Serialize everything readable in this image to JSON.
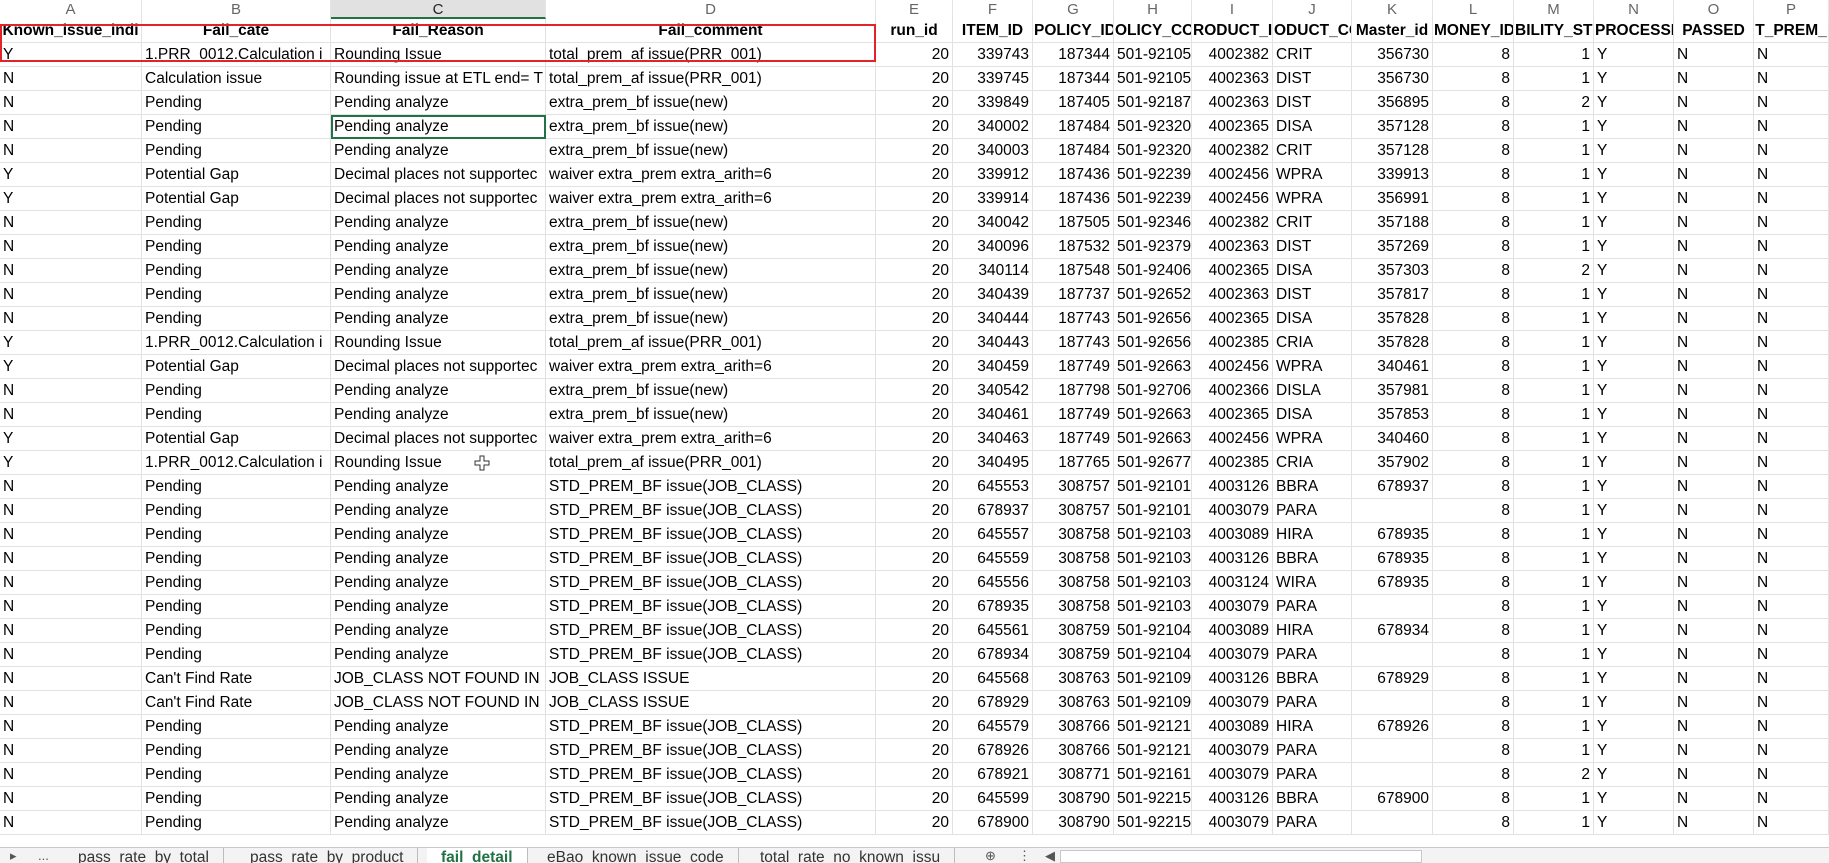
{
  "sheet": {
    "column_letters": [
      "A",
      "B",
      "C",
      "D",
      "E",
      "F",
      "G",
      "H",
      "I",
      "J",
      "K",
      "L",
      "M",
      "N",
      "O",
      "P"
    ],
    "selected_column": "C",
    "header_row": [
      "Known_issue_indi",
      "Fail_cate",
      "Fail_Reason",
      "Fail_comment",
      "run_id",
      "ITEM_ID",
      "POLICY_ID",
      "OLICY_COD",
      "RODUCT_I",
      "ODUCT_CO",
      "Master_id",
      "MONEY_ID",
      "BILITY_ST",
      "PROCESSED",
      "PASSED",
      "T_PREM_"
    ],
    "rows": [
      [
        "Y",
        "1.PRR_0012.Calculation i",
        "Rounding Issue",
        "total_prem_af issue(PRR_001)",
        "20",
        "339743",
        "187344",
        "501-92105",
        "4002382",
        "CRIT",
        "356730",
        "8",
        "1",
        "Y",
        "N",
        "N"
      ],
      [
        "N",
        "Calculation issue",
        "Rounding issue at ETL end= T",
        "total_prem_af issue(PRR_001)",
        "20",
        "339745",
        "187344",
        "501-92105",
        "4002363",
        "DIST",
        "356730",
        "8",
        "1",
        "Y",
        "N",
        "N"
      ],
      [
        "N",
        "Pending",
        "Pending analyze",
        "extra_prem_bf issue(new)",
        "20",
        "339849",
        "187405",
        "501-92187",
        "4002363",
        "DIST",
        "356895",
        "8",
        "2",
        "Y",
        "N",
        "N"
      ],
      [
        "N",
        "Pending",
        "Pending analyze",
        "extra_prem_bf issue(new)",
        "20",
        "340002",
        "187484",
        "501-92320",
        "4002365",
        "DISA",
        "357128",
        "8",
        "1",
        "Y",
        "N",
        "N"
      ],
      [
        "N",
        "Pending",
        "Pending analyze",
        "extra_prem_bf issue(new)",
        "20",
        "340003",
        "187484",
        "501-92320",
        "4002382",
        "CRIT",
        "357128",
        "8",
        "1",
        "Y",
        "N",
        "N"
      ],
      [
        "Y",
        "Potential Gap",
        "Decimal places not supportec",
        "waiver extra_prem extra_arith=6",
        "20",
        "339912",
        "187436",
        "501-92239",
        "4002456",
        "WPRA",
        "339913",
        "8",
        "1",
        "Y",
        "N",
        "N"
      ],
      [
        "Y",
        "Potential Gap",
        "Decimal places not supportec",
        "waiver extra_prem extra_arith=6",
        "20",
        "339914",
        "187436",
        "501-92239",
        "4002456",
        "WPRA",
        "356991",
        "8",
        "1",
        "Y",
        "N",
        "N"
      ],
      [
        "N",
        "Pending",
        "Pending analyze",
        "extra_prem_bf issue(new)",
        "20",
        "340042",
        "187505",
        "501-92346",
        "4002382",
        "CRIT",
        "357188",
        "8",
        "1",
        "Y",
        "N",
        "N"
      ],
      [
        "N",
        "Pending",
        "Pending analyze",
        "extra_prem_bf issue(new)",
        "20",
        "340096",
        "187532",
        "501-92379",
        "4002363",
        "DIST",
        "357269",
        "8",
        "1",
        "Y",
        "N",
        "N"
      ],
      [
        "N",
        "Pending",
        "Pending analyze",
        "extra_prem_bf issue(new)",
        "20",
        "340114",
        "187548",
        "501-92406",
        "4002365",
        "DISA",
        "357303",
        "8",
        "2",
        "Y",
        "N",
        "N"
      ],
      [
        "N",
        "Pending",
        "Pending analyze",
        "extra_prem_bf issue(new)",
        "20",
        "340439",
        "187737",
        "501-92652",
        "4002363",
        "DIST",
        "357817",
        "8",
        "1",
        "Y",
        "N",
        "N"
      ],
      [
        "N",
        "Pending",
        "Pending analyze",
        "extra_prem_bf issue(new)",
        "20",
        "340444",
        "187743",
        "501-92656",
        "4002365",
        "DISA",
        "357828",
        "8",
        "1",
        "Y",
        "N",
        "N"
      ],
      [
        "Y",
        "1.PRR_0012.Calculation i",
        "Rounding Issue",
        "total_prem_af issue(PRR_001)",
        "20",
        "340443",
        "187743",
        "501-92656",
        "4002385",
        "CRIA",
        "357828",
        "8",
        "1",
        "Y",
        "N",
        "N"
      ],
      [
        "Y",
        "Potential Gap",
        "Decimal places not supportec",
        "waiver extra_prem extra_arith=6",
        "20",
        "340459",
        "187749",
        "501-92663",
        "4002456",
        "WPRA",
        "340461",
        "8",
        "1",
        "Y",
        "N",
        "N"
      ],
      [
        "N",
        "Pending",
        "Pending analyze",
        "extra_prem_bf issue(new)",
        "20",
        "340542",
        "187798",
        "501-92706",
        "4002366",
        "DISLA",
        "357981",
        "8",
        "1",
        "Y",
        "N",
        "N"
      ],
      [
        "N",
        "Pending",
        "Pending analyze",
        "extra_prem_bf issue(new)",
        "20",
        "340461",
        "187749",
        "501-92663",
        "4002365",
        "DISA",
        "357853",
        "8",
        "1",
        "Y",
        "N",
        "N"
      ],
      [
        "Y",
        "Potential Gap",
        "Decimal places not supportec",
        "waiver extra_prem extra_arith=6",
        "20",
        "340463",
        "187749",
        "501-92663",
        "4002456",
        "WPRA",
        "340460",
        "8",
        "1",
        "Y",
        "N",
        "N"
      ],
      [
        "Y",
        "1.PRR_0012.Calculation i",
        "Rounding Issue",
        "total_prem_af issue(PRR_001)",
        "20",
        "340495",
        "187765",
        "501-92677",
        "4002385",
        "CRIA",
        "357902",
        "8",
        "1",
        "Y",
        "N",
        "N"
      ],
      [
        "N",
        "Pending",
        "Pending analyze",
        "STD_PREM_BF issue(JOB_CLASS)",
        "20",
        "645553",
        "308757",
        "501-92101",
        "4003126",
        "BBRA",
        "678937",
        "8",
        "1",
        "Y",
        "N",
        "N"
      ],
      [
        "N",
        "Pending",
        "Pending analyze",
        "STD_PREM_BF issue(JOB_CLASS)",
        "20",
        "678937",
        "308757",
        "501-92101",
        "4003079",
        "PARA",
        "",
        "8",
        "1",
        "Y",
        "N",
        "N"
      ],
      [
        "N",
        "Pending",
        "Pending analyze",
        "STD_PREM_BF issue(JOB_CLASS)",
        "20",
        "645557",
        "308758",
        "501-92103",
        "4003089",
        "HIRA",
        "678935",
        "8",
        "1",
        "Y",
        "N",
        "N"
      ],
      [
        "N",
        "Pending",
        "Pending analyze",
        "STD_PREM_BF issue(JOB_CLASS)",
        "20",
        "645559",
        "308758",
        "501-92103",
        "4003126",
        "BBRA",
        "678935",
        "8",
        "1",
        "Y",
        "N",
        "N"
      ],
      [
        "N",
        "Pending",
        "Pending analyze",
        "STD_PREM_BF issue(JOB_CLASS)",
        "20",
        "645556",
        "308758",
        "501-92103",
        "4003124",
        "WIRA",
        "678935",
        "8",
        "1",
        "Y",
        "N",
        "N"
      ],
      [
        "N",
        "Pending",
        "Pending analyze",
        "STD_PREM_BF issue(JOB_CLASS)",
        "20",
        "678935",
        "308758",
        "501-92103",
        "4003079",
        "PARA",
        "",
        "8",
        "1",
        "Y",
        "N",
        "N"
      ],
      [
        "N",
        "Pending",
        "Pending analyze",
        "STD_PREM_BF issue(JOB_CLASS)",
        "20",
        "645561",
        "308759",
        "501-92104",
        "4003089",
        "HIRA",
        "678934",
        "8",
        "1",
        "Y",
        "N",
        "N"
      ],
      [
        "N",
        "Pending",
        "Pending analyze",
        "STD_PREM_BF issue(JOB_CLASS)",
        "20",
        "678934",
        "308759",
        "501-92104",
        "4003079",
        "PARA",
        "",
        "8",
        "1",
        "Y",
        "N",
        "N"
      ],
      [
        "N",
        "Can't Find Rate",
        " JOB_CLASS NOT FOUND IN F",
        "JOB_CLASS ISSUE",
        "20",
        "645568",
        "308763",
        "501-92109",
        "4003126",
        "BBRA",
        "678929",
        "8",
        "1",
        "Y",
        "N",
        "N"
      ],
      [
        "N",
        "Can't Find Rate",
        " JOB_CLASS NOT FOUND IN F",
        "JOB_CLASS ISSUE",
        "20",
        "678929",
        "308763",
        "501-92109",
        "4003079",
        "PARA",
        "",
        "8",
        "1",
        "Y",
        "N",
        "N"
      ],
      [
        "N",
        "Pending",
        "Pending analyze",
        "STD_PREM_BF issue(JOB_CLASS)",
        "20",
        "645579",
        "308766",
        "501-92121",
        "4003089",
        "HIRA",
        "678926",
        "8",
        "1",
        "Y",
        "N",
        "N"
      ],
      [
        "N",
        "Pending",
        "Pending analyze",
        "STD_PREM_BF issue(JOB_CLASS)",
        "20",
        "678926",
        "308766",
        "501-92121",
        "4003079",
        "PARA",
        "",
        "8",
        "1",
        "Y",
        "N",
        "N"
      ],
      [
        "N",
        "Pending",
        "Pending analyze",
        "STD_PREM_BF issue(JOB_CLASS)",
        "20",
        "678921",
        "308771",
        "501-92161",
        "4003079",
        "PARA",
        "",
        "8",
        "2",
        "Y",
        "N",
        "N"
      ],
      [
        "N",
        "Pending",
        "Pending analyze",
        "STD_PREM_BF issue(JOB_CLASS)",
        "20",
        "645599",
        "308790",
        "501-92215",
        "4003126",
        "BBRA",
        "678900",
        "8",
        "1",
        "Y",
        "N",
        "N"
      ],
      [
        "N",
        "Pending",
        "Pending analyze",
        "STD_PREM_BF issue(JOB_CLASS)",
        "20",
        "678900",
        "308790",
        "501-92215",
        "4003079",
        "PARA",
        "",
        "8",
        "1",
        "Y",
        "N",
        "N"
      ]
    ]
  },
  "tabs": [
    {
      "label": "pass_rate_by_total",
      "active": false
    },
    {
      "label": "pass_rate_by_product",
      "active": false
    },
    {
      "label": "fail_detail",
      "active": true
    },
    {
      "label": "eBao_known_issue_code",
      "active": false
    },
    {
      "label": "total_rate_no_known_issu",
      "active": false
    }
  ],
  "colors": {
    "accent": "#217346",
    "highlight_box": "#e0242a"
  }
}
